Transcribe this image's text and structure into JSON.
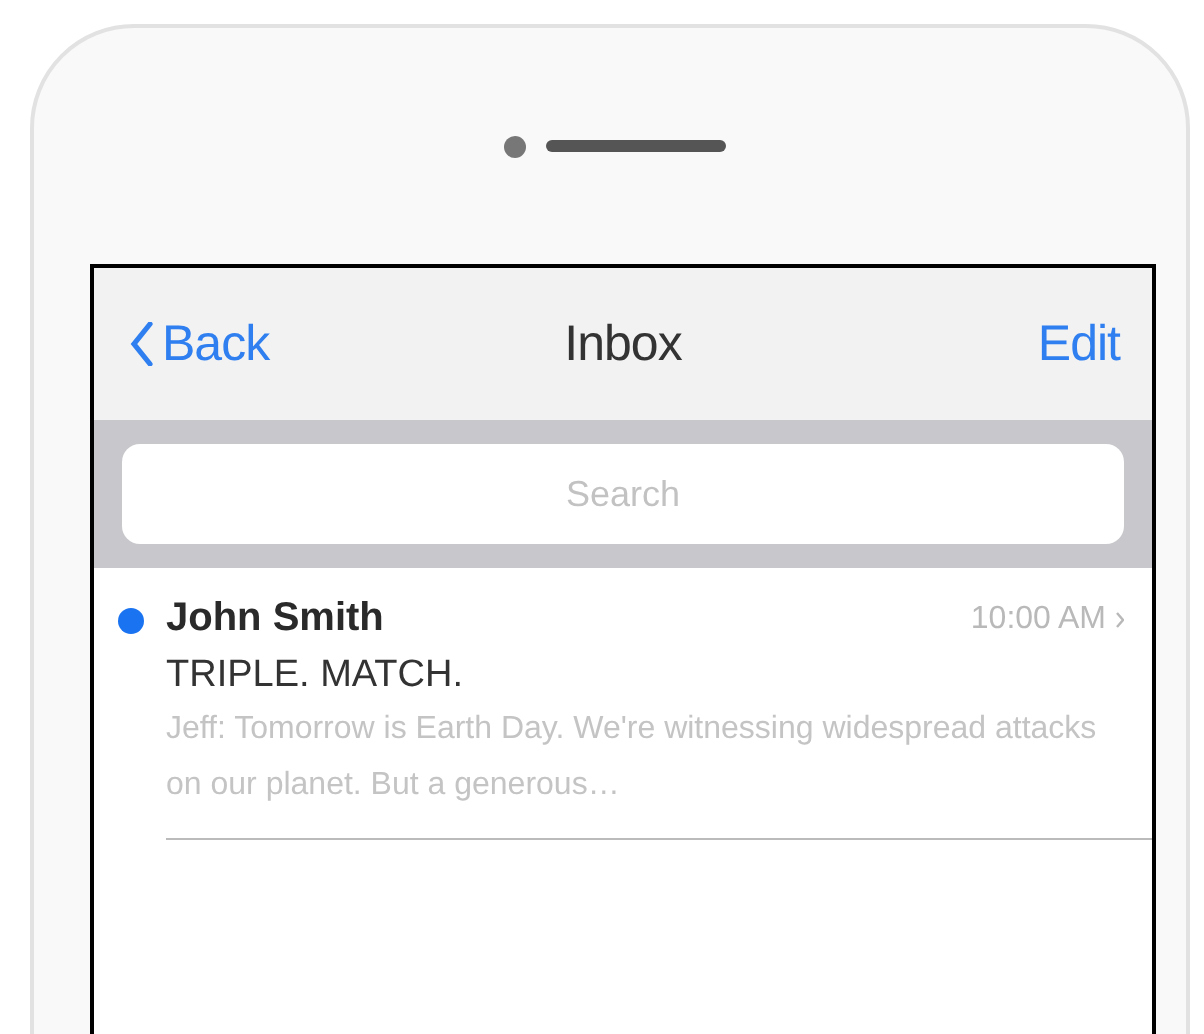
{
  "nav_bar": {
    "back": "Back",
    "title": "Inbox",
    "action": "Edit"
  },
  "search": {
    "placeholder": "Search"
  },
  "messages": [
    {
      "sender": "John Smith",
      "time": "10:00 AM",
      "unread": true,
      "subject": "TRIPLE. MATCH.",
      "preview": "Jeff: Tomorrow is Earth Day. We're witnessing widespread attacks on our planet. But a generous…"
    }
  ]
}
